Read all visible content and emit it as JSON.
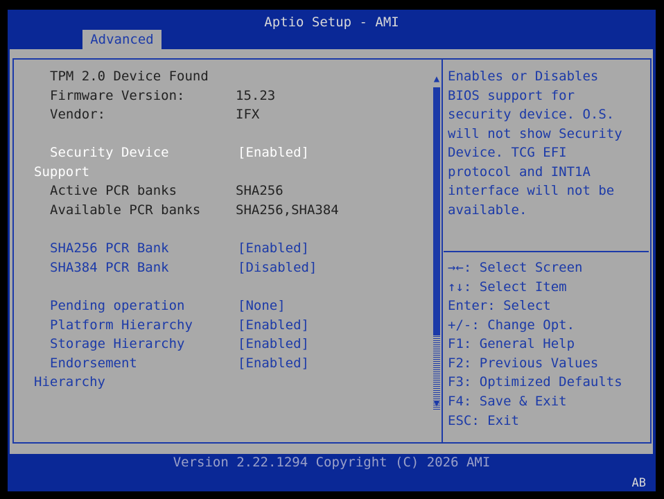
{
  "window": {
    "title": "Aptio Setup - AMI"
  },
  "tabs": [
    {
      "label": "Advanced"
    }
  ],
  "settings": {
    "tpm_found": "TPM 2.0 Device Found",
    "firmware_label": "Firmware Version:",
    "firmware_value": "15.23",
    "vendor_label": "Vendor:",
    "vendor_value": "IFX",
    "security_device_label_1": "Security Device",
    "security_device_label_2": "Support",
    "security_device_value": "[Enabled]",
    "active_pcr_label": "Active PCR banks",
    "active_pcr_value": "SHA256",
    "available_pcr_label": "Available PCR banks",
    "available_pcr_value": "SHA256,SHA384",
    "sha256_label": "SHA256 PCR Bank",
    "sha256_value": "[Enabled]",
    "sha384_label": "SHA384 PCR Bank",
    "sha384_value": "[Disabled]",
    "pending_label": "Pending operation",
    "pending_value": "[None]",
    "platform_label": "Platform Hierarchy",
    "platform_value": "[Enabled]",
    "storage_label": "Storage Hierarchy",
    "storage_value": "[Enabled]",
    "endorsement_label_1": "Endorsement",
    "endorsement_label_2": "Hierarchy",
    "endorsement_value": "[Enabled]"
  },
  "help": {
    "description": [
      "Enables or Disables",
      "BIOS support for",
      "security device. O.S.",
      "will not show Security",
      "Device. TCG EFI",
      "protocol and INT1A",
      "interface will not be",
      "available."
    ],
    "keys": [
      "→←: Select Screen",
      "↑↓: Select Item",
      "Enter: Select",
      "+/-: Change Opt.",
      "F1: General Help",
      "F2: Previous Values",
      "F3: Optimized Defaults",
      "F4: Save & Exit",
      "ESC: Exit"
    ]
  },
  "footer": {
    "version": "Version 2.22.1294 Copyright (C) 2026 AMI",
    "badge": "AB"
  },
  "colors": {
    "blue": "#0a2896",
    "gray": "#a9a9a9",
    "option": "#1c3aa8",
    "selected": "#ffffff"
  }
}
